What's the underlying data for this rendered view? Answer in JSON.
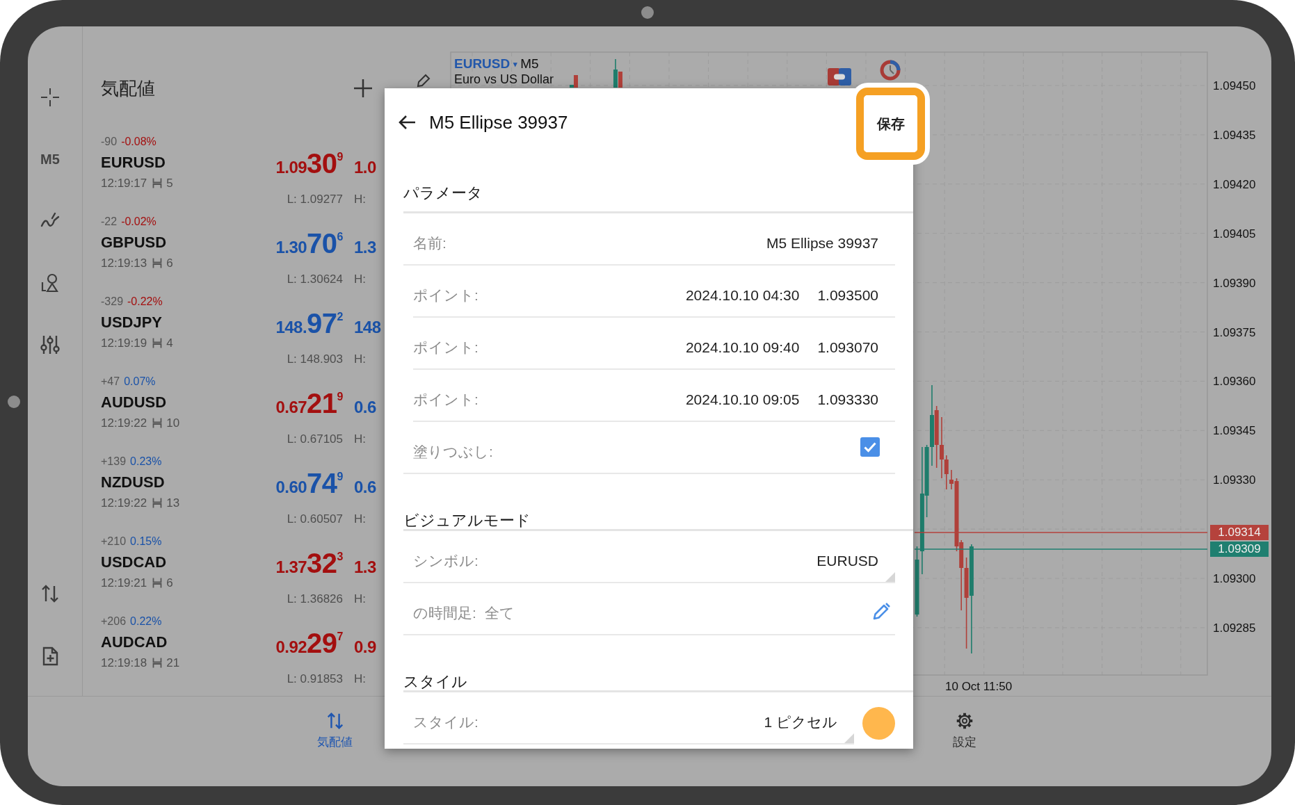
{
  "toolbar": {
    "timeframe": "M5"
  },
  "quotes": {
    "title": "気配値",
    "rows": [
      {
        "change": "-90",
        "change_pct": "-0.08%",
        "change_up": false,
        "symbol": "EURUSD",
        "time": "12:19:17",
        "spread": "5",
        "bid": {
          "prefix": "1.09",
          "big": "30",
          "pip": "9",
          "up": false
        },
        "ask": {
          "text": "1.0",
          "up": false
        },
        "low": "L: 1.09277",
        "high": "H:"
      },
      {
        "change": "-22",
        "change_pct": "-0.02%",
        "change_up": false,
        "symbol": "GBPUSD",
        "time": "12:19:13",
        "spread": "6",
        "bid": {
          "prefix": "1.30",
          "big": "70",
          "pip": "6",
          "up": true
        },
        "ask": {
          "text": "1.3",
          "up": true
        },
        "low": "L: 1.30624",
        "high": "H:"
      },
      {
        "change": "-329",
        "change_pct": "-0.22%",
        "change_up": false,
        "symbol": "USDJPY",
        "time": "12:19:19",
        "spread": "4",
        "bid": {
          "prefix": "148.",
          "big": "97",
          "pip": "2",
          "up": true
        },
        "ask": {
          "text": "148",
          "up": true
        },
        "low": "L: 148.903",
        "high": "H:"
      },
      {
        "change": "+47",
        "change_pct": "0.07%",
        "change_up": true,
        "symbol": "AUDUSD",
        "time": "12:19:22",
        "spread": "10",
        "bid": {
          "prefix": "0.67",
          "big": "21",
          "pip": "9",
          "up": false
        },
        "ask": {
          "text": "0.6",
          "up": true
        },
        "low": "L: 0.67105",
        "high": "H:"
      },
      {
        "change": "+139",
        "change_pct": "0.23%",
        "change_up": true,
        "symbol": "NZDUSD",
        "time": "12:19:22",
        "spread": "13",
        "bid": {
          "prefix": "0.60",
          "big": "74",
          "pip": "9",
          "up": true
        },
        "ask": {
          "text": "0.6",
          "up": true
        },
        "low": "L: 0.60507",
        "high": "H:"
      },
      {
        "change": "+210",
        "change_pct": "0.15%",
        "change_up": true,
        "symbol": "USDCAD",
        "time": "12:19:21",
        "spread": "6",
        "bid": {
          "prefix": "1.37",
          "big": "32",
          "pip": "3",
          "up": false
        },
        "ask": {
          "text": "1.3",
          "up": false
        },
        "low": "L: 1.36826",
        "high": "H:"
      },
      {
        "change": "+206",
        "change_pct": "0.22%",
        "change_up": true,
        "symbol": "AUDCAD",
        "time": "12:19:18",
        "spread": "21",
        "bid": {
          "prefix": "0.92",
          "big": "29",
          "pip": "7",
          "up": false
        },
        "ask": {
          "text": "0.9",
          "up": false
        },
        "low": "L: 0.91853",
        "high": "H:"
      }
    ]
  },
  "chart": {
    "symbol": "EURUSD",
    "caret": "▾",
    "timeframe": "M5",
    "description": "Euro vs US Dollar",
    "price_labels": [
      "1.09450",
      "1.09435",
      "1.09420",
      "1.09405",
      "1.09390",
      "1.09375",
      "1.09360",
      "1.09345",
      "1.09330",
      "1.09300",
      "1.09285"
    ],
    "price_tags": [
      {
        "text": "1.09314",
        "color": "#b5423c"
      },
      {
        "text": "1.09309",
        "color": "#1f7f70"
      }
    ],
    "time_label": "10 Oct 11:50"
  },
  "dialog": {
    "title": "M5 Ellipse 39937",
    "save": "保存",
    "sections": [
      {
        "title": "パラメータ",
        "rows": [
          {
            "kind": "text",
            "label": "名前:",
            "value": "M5 Ellipse 39937"
          },
          {
            "kind": "point",
            "label": "ポイント:",
            "time": "2024.10.10 04:30",
            "price": "1.093500"
          },
          {
            "kind": "point",
            "label": "ポイント:",
            "time": "2024.10.10 09:40",
            "price": "1.093070"
          },
          {
            "kind": "point",
            "label": "ポイント:",
            "time": "2024.10.10 09:05",
            "price": "1.093330"
          },
          {
            "kind": "checkbox",
            "label": "塗りつぶし:",
            "checked": true
          }
        ]
      },
      {
        "title": "ビジュアルモード",
        "rows": [
          {
            "kind": "select",
            "label": "シンボル:",
            "value": "EURUSD"
          },
          {
            "kind": "timeframes",
            "label": "の時間足:",
            "value": "全て"
          }
        ]
      },
      {
        "title": "スタイル",
        "rows": [
          {
            "kind": "style",
            "label": "スタイル:",
            "value": "1 ピクセル",
            "color": "#ffb74d"
          }
        ]
      }
    ]
  },
  "nav": {
    "items": [
      {
        "kind": "quotes",
        "label": "気配値",
        "selected": true
      },
      {
        "kind": "settings",
        "label": "設定",
        "selected": false
      }
    ]
  }
}
